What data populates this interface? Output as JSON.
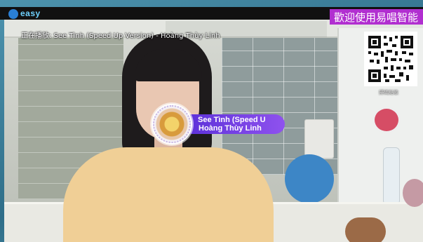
{
  "brand": {
    "logo_text": "easy",
    "accent": "#6fd2ff"
  },
  "now_playing": {
    "label": "正在播放: See Tình (Speed Up Version) - Hoàng Thùy Linh"
  },
  "banner": {
    "text": "歡迎使用易唱智能",
    "color": "#b12fd0"
  },
  "qr": {
    "caption": "掃碼點歌"
  },
  "song_bubble": {
    "title": "See Tình (Speed U",
    "artist": "Hoàng Thùy Linh",
    "gradient_start": "#5a2fd8",
    "gradient_end": "#8f52ee"
  }
}
